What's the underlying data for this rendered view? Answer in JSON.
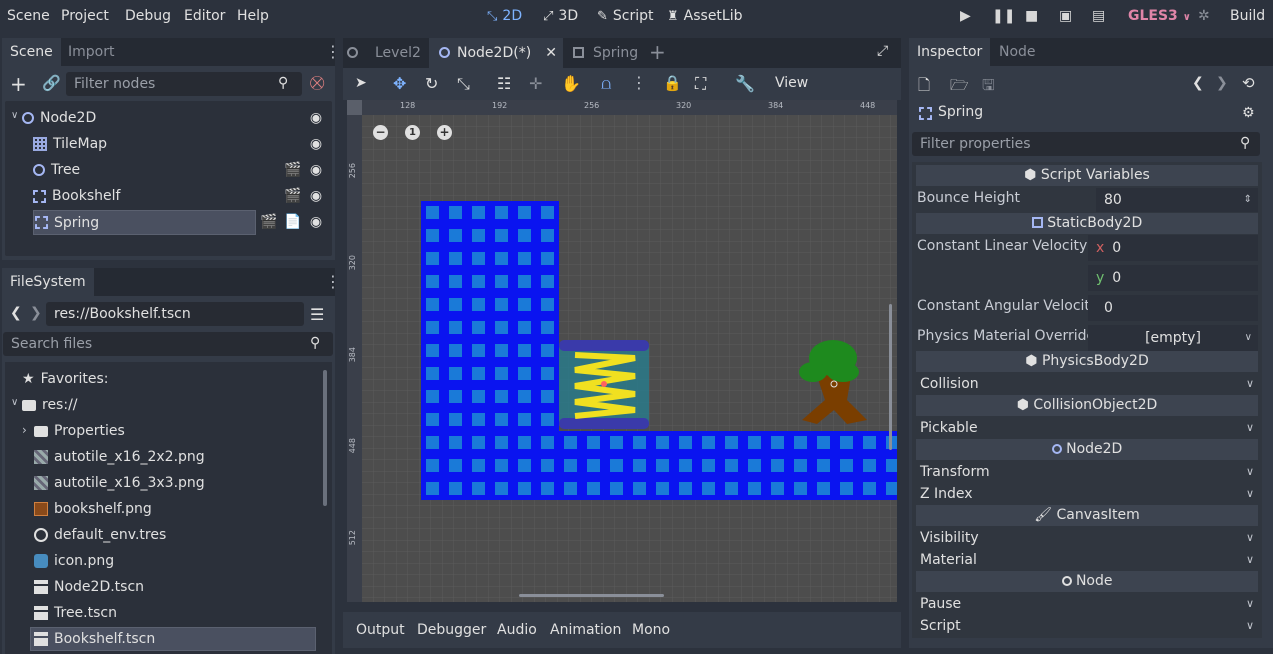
{
  "menubar": {
    "items": [
      "Scene",
      "Project",
      "Debug",
      "Editor",
      "Help"
    ],
    "modes": [
      {
        "label": "2D",
        "icon": "2d-icon",
        "active": true
      },
      {
        "label": "3D",
        "icon": "3d-icon",
        "active": false
      },
      {
        "label": "Script",
        "icon": "script-icon",
        "active": false
      },
      {
        "label": "AssetLib",
        "icon": "assetlib-icon",
        "active": false
      }
    ],
    "renderer": "GLES3",
    "build": "Build"
  },
  "scene_panel": {
    "tabs": [
      "Scene",
      "Import"
    ],
    "filter_placeholder": "Filter nodes",
    "nodes": [
      {
        "label": "Node2D",
        "icon": "node2d-icon"
      },
      {
        "label": "TileMap",
        "icon": "tilemap-icon"
      },
      {
        "label": "Tree",
        "icon": "node2d-icon"
      },
      {
        "label": "Bookshelf",
        "icon": "staticbody-icon"
      },
      {
        "label": "Spring",
        "icon": "staticbody-icon"
      }
    ]
  },
  "filesystem": {
    "tab": "FileSystem",
    "path": "res://Bookshelf.tscn",
    "search_placeholder": "Search files",
    "items": [
      {
        "label": "Favorites:",
        "icon": "star-icon"
      },
      {
        "label": "res://",
        "icon": "folder-icon"
      },
      {
        "label": "Properties",
        "icon": "folder-icon"
      },
      {
        "label": "autotile_x16_2x2.png",
        "icon": "image-icon"
      },
      {
        "label": "autotile_x16_3x3.png",
        "icon": "image-icon"
      },
      {
        "label": "bookshelf.png",
        "icon": "image-icon"
      },
      {
        "label": "default_env.tres",
        "icon": "globe-icon"
      },
      {
        "label": "icon.png",
        "icon": "image-icon"
      },
      {
        "label": "Node2D.tscn",
        "icon": "scene-icon"
      },
      {
        "label": "Tree.tscn",
        "icon": "scene-icon"
      },
      {
        "label": "Bookshelf.tscn",
        "icon": "scene-icon"
      }
    ]
  },
  "editor_tabs": [
    "Level2",
    "Node2D(*)",
    "Spring"
  ],
  "toolbar": {
    "view": "View"
  },
  "rulers": {
    "h": [
      "128",
      "192",
      "256",
      "320",
      "384",
      "448"
    ],
    "v": [
      "256",
      "320",
      "384",
      "448",
      "512"
    ]
  },
  "zoom": {
    "reset": "1"
  },
  "bottom_tabs": [
    "Output",
    "Debugger",
    "Audio",
    "Animation",
    "Mono"
  ],
  "inspector": {
    "tabs": [
      "Inspector",
      "Node"
    ],
    "object_name": "Spring",
    "filter_placeholder": "Filter properties",
    "sections": {
      "script_variables": "Script Variables",
      "staticbody": "StaticBody2D",
      "physicsbody": "PhysicsBody2D",
      "collisionobject": "CollisionObject2D",
      "node2d": "Node2D",
      "canvasitem": "CanvasItem",
      "node": "Node"
    },
    "props": {
      "bounce_height_label": "Bounce Height",
      "bounce_height": "80",
      "const_linear_label": "Constant Linear Velocity",
      "x_label": "x",
      "x_val": "0",
      "y_label": "y",
      "y_val": "0",
      "const_angular_label": "Constant Angular Velocity",
      "const_angular": "0",
      "phys_mat_label": "Physics Material Override",
      "phys_mat": "[empty]",
      "collision": "Collision",
      "pickable": "Pickable",
      "transform": "Transform",
      "z_index": "Z Index",
      "visibility": "Visibility",
      "material": "Material",
      "pause": "Pause",
      "script": "Script"
    }
  },
  "colors": {
    "accent": "#7eb3ff",
    "renderer": "#e085a8",
    "tile_blue": "#0a14f0",
    "tile_inner": "#1a7ad8"
  }
}
